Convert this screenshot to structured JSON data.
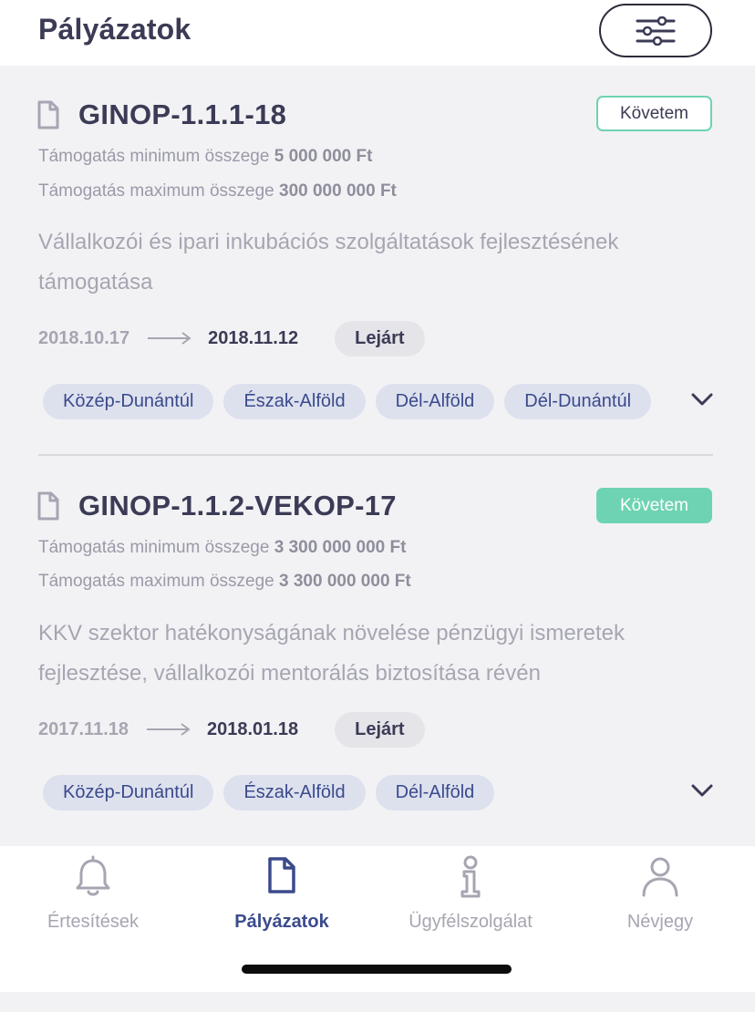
{
  "header": {
    "title": "Pályázatok",
    "filter_icon": "sliders-icon"
  },
  "grants": [
    {
      "code": "GINOP-1.1.1-18",
      "follow_label": "Követem",
      "followed": false,
      "min_label": "Támogatás minimum összege",
      "min_value": "5 000 000 Ft",
      "max_label": "Támogatás maximum összege",
      "max_value": "300 000 000 Ft",
      "description": "Vállalkozói és ipari inkubációs szolgáltatások fejlesztésének támogatása",
      "date_start": "2018.10.17",
      "date_end": "2018.11.12",
      "status": "Lejárt",
      "regions": [
        "Közép-Dunántúl",
        "Észak-Alföld",
        "Dél-Alföld",
        "Dél-Dunántúl"
      ]
    },
    {
      "code": "GINOP-1.1.2-VEKOP-17",
      "follow_label": "Követem",
      "followed": true,
      "min_label": "Támogatás minimum összege",
      "min_value": "3 300 000 000 Ft",
      "max_label": "Támogatás maximum összege",
      "max_value": "3 300 000 000 Ft",
      "description": "KKV szektor hatékonyságának növelése pénzügyi ismeretek fejlesztése, vállalkozói mentorálás biztosítása révén",
      "date_start": "2017.11.18",
      "date_end": "2018.01.18",
      "status": "Lejárt",
      "regions": [
        "Közép-Dunántúl",
        "Észak-Alföld",
        "Dél-Alföld"
      ]
    }
  ],
  "tabbar": {
    "items": [
      {
        "label": "Értesítések",
        "icon": "bell-icon",
        "active": false
      },
      {
        "label": "Pályázatok",
        "icon": "document-icon",
        "active": true
      },
      {
        "label": "Ügyfélszolgálat",
        "icon": "info-icon",
        "active": false
      },
      {
        "label": "Névjegy",
        "icon": "person-icon",
        "active": false
      }
    ]
  },
  "colors": {
    "accent_green": "#6ed3b2",
    "active_tab": "#3b4a8c",
    "tag_bg": "#dde1ee",
    "tag_text": "#3a4a8c",
    "status_bg": "#e4e4e9"
  }
}
